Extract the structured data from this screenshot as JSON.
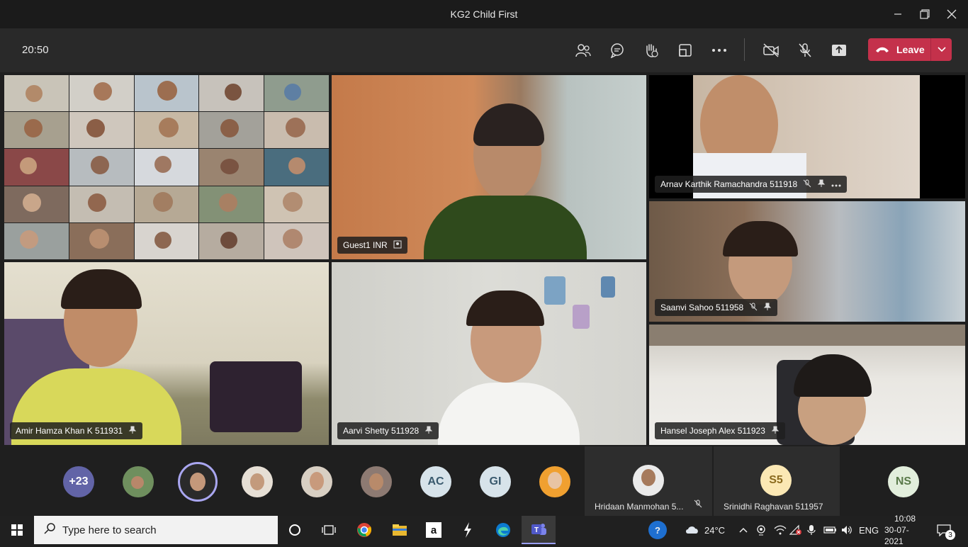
{
  "window": {
    "title": "KG2 Child First"
  },
  "toolbar": {
    "elapsed": "20:50",
    "leave_label": "Leave"
  },
  "tiles": {
    "guest": {
      "name": "Guest1 INR"
    },
    "arnav": {
      "name": "Arnav Karthik Ramachandra 511918"
    },
    "saanvi": {
      "name": "Saanvi Sahoo 511958"
    },
    "amir": {
      "name": "Amir Hamza Khan K 511931"
    },
    "aarvi": {
      "name": "Aarvi Shetty 511928"
    },
    "hansel": {
      "name": "Hansel Joseph Alex 511923"
    }
  },
  "strip": {
    "overflow_count": "+23",
    "initials": {
      "ac": "AC",
      "gi": "GI",
      "s5": "S5",
      "ns": "NS"
    },
    "hridaan": "Hridaan Manmohan 5...",
    "srinidhi": "Srinidhi Raghavan 511957"
  },
  "taskbar": {
    "search_placeholder": "Type here to search",
    "weather": "24°C",
    "language": "ENG",
    "time": "10:08",
    "date": "30-07-2021",
    "notifications": "3"
  },
  "colors": {
    "leave": "#c4314b",
    "accent": "#6264a7",
    "toolbar": "#292929"
  }
}
